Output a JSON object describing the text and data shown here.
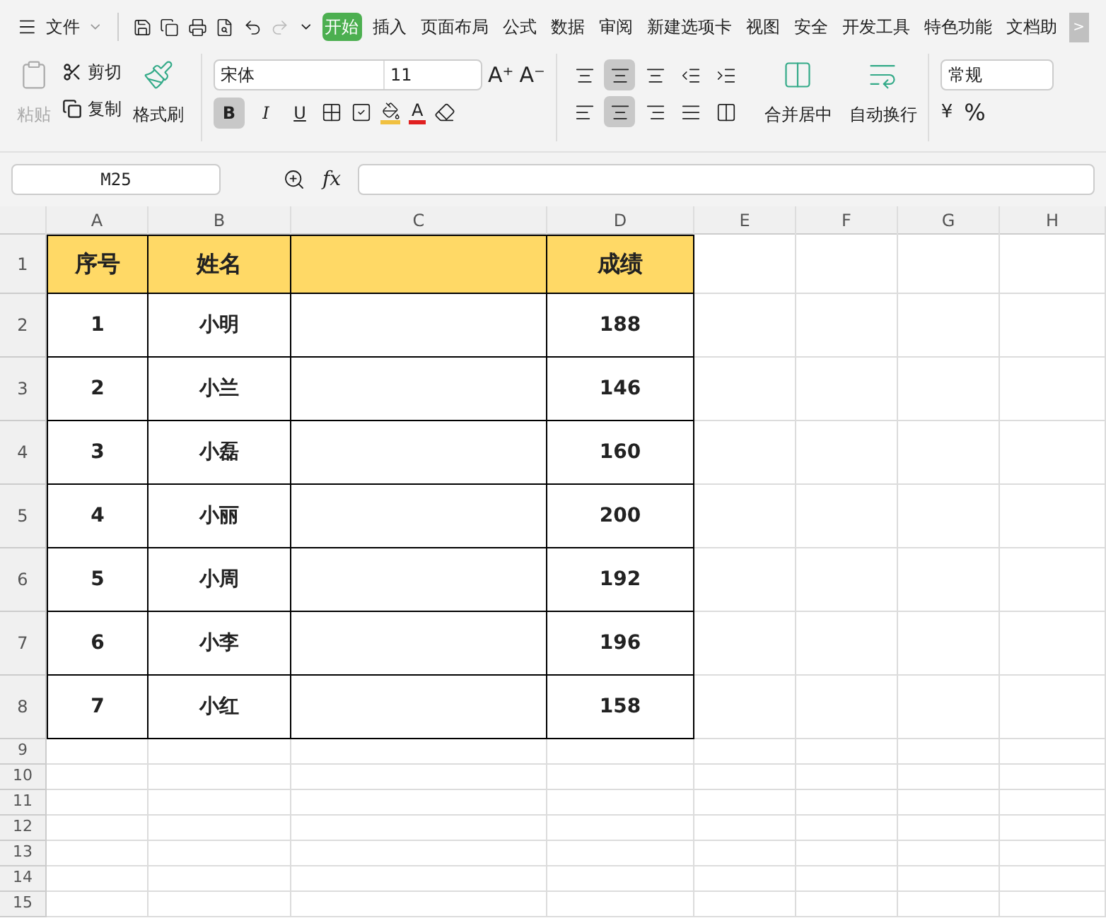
{
  "menu": {
    "file_label": "文件",
    "tabs": [
      {
        "label": "开始",
        "selected": true
      },
      {
        "label": "插入",
        "selected": false
      },
      {
        "label": "页面布局",
        "selected": false
      },
      {
        "label": "公式",
        "selected": false
      },
      {
        "label": "数据",
        "selected": false
      },
      {
        "label": "审阅",
        "selected": false
      },
      {
        "label": "新建选项卡",
        "selected": false
      },
      {
        "label": "视图",
        "selected": false
      },
      {
        "label": "安全",
        "selected": false
      },
      {
        "label": "开发工具",
        "selected": false
      },
      {
        "label": "特色功能",
        "selected": false
      },
      {
        "label": "文档助",
        "selected": false
      }
    ],
    "more": ">"
  },
  "ribbon": {
    "paste": "粘贴",
    "cut": "剪切",
    "copy": "复制",
    "format_painter": "格式刷",
    "font": "宋体",
    "font_size": "11",
    "bold": {
      "label": "B",
      "selected": true
    },
    "font_grow": "A⁺",
    "font_shrink": "A⁻",
    "italic": {
      "label": "I",
      "selected": false
    },
    "underline": {
      "label": "U",
      "selected": false
    },
    "font_color": "A",
    "currency": "¥",
    "align_top": [
      {
        "kind": "top",
        "selected": false
      },
      {
        "kind": "middle",
        "selected": true
      },
      {
        "kind": "bottom",
        "selected": false
      },
      {
        "kind": "outdent",
        "selected": false
      },
      {
        "kind": "indent",
        "selected": false
      }
    ],
    "align_bottom": [
      {
        "kind": "left",
        "selected": false
      },
      {
        "kind": "center",
        "selected": true
      },
      {
        "kind": "right",
        "selected": false
      },
      {
        "kind": "justify",
        "selected": false
      },
      {
        "kind": "distribute",
        "selected": false
      }
    ],
    "merge": "合并居中",
    "wrap": "自动换行",
    "number_format": "常规",
    "percent": "%"
  },
  "formula_bar": {
    "name_box": "M25",
    "fx": "fx"
  },
  "sheet": {
    "columns": [
      "A",
      "B",
      "C",
      "D",
      "E",
      "F",
      "G",
      "H"
    ],
    "header_row": {
      "number": "1",
      "cells": [
        "序号",
        "姓名",
        "",
        "成绩"
      ]
    },
    "rows": [
      {
        "number": "2",
        "cells": [
          "1",
          "小明",
          "",
          "188"
        ]
      },
      {
        "number": "3",
        "cells": [
          "2",
          "小兰",
          "",
          "146"
        ]
      },
      {
        "number": "4",
        "cells": [
          "3",
          "小磊",
          "",
          "160"
        ]
      },
      {
        "number": "5",
        "cells": [
          "4",
          "小丽",
          "",
          "200"
        ]
      },
      {
        "number": "6",
        "cells": [
          "5",
          "小周",
          "",
          "192"
        ]
      },
      {
        "number": "7",
        "cells": [
          "6",
          "小李",
          "",
          "196"
        ]
      },
      {
        "number": "8",
        "cells": [
          "7",
          "小红",
          "",
          "158"
        ]
      }
    ],
    "empty_rows": [
      "9",
      "10",
      "11",
      "12",
      "13",
      "14",
      "15"
    ]
  }
}
